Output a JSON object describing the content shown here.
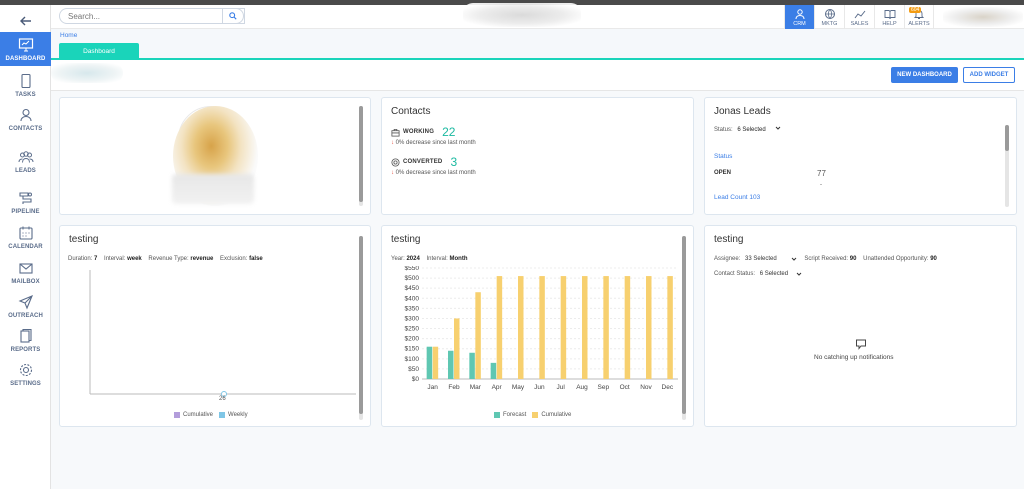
{
  "sidebar": {
    "items": [
      {
        "label": "DASHBOARD",
        "icon": "dashboard-icon"
      },
      {
        "label": "TASKS",
        "icon": "tasks-icon"
      },
      {
        "label": "CONTACTS",
        "icon": "contacts-icon"
      },
      {
        "label": "LEADS",
        "icon": "leads-icon"
      },
      {
        "label": "PIPELINE",
        "icon": "pipeline-icon"
      },
      {
        "label": "CALENDAR",
        "icon": "calendar-icon"
      },
      {
        "label": "MAILBOX",
        "icon": "mailbox-icon"
      },
      {
        "label": "OUTREACH",
        "icon": "outreach-icon"
      },
      {
        "label": "REPORTS",
        "icon": "reports-icon"
      },
      {
        "label": "SETTINGS",
        "icon": "settings-icon"
      }
    ]
  },
  "header": {
    "search_placeholder": "Search...",
    "buttons": [
      {
        "label": "CRM"
      },
      {
        "label": "MKTG"
      },
      {
        "label": "SALES"
      },
      {
        "label": "HELP"
      },
      {
        "label": "ALERTS",
        "badge": "604"
      }
    ]
  },
  "breadcrumb": {
    "home": "Home"
  },
  "tabs": {
    "dashboard": "Dashboard"
  },
  "toolbar": {
    "new_dashboard": "NEW DASHBOARD",
    "add_widget": "ADD WIDGET"
  },
  "contacts_card": {
    "title": "Contacts",
    "working_label": "WORKING",
    "working_value": "22",
    "working_sub": "0% decrease since last month",
    "converted_label": "CONVERTED",
    "converted_value": "3",
    "converted_sub": "0% decrease since last month"
  },
  "leads_card": {
    "title": "Jonas Leads",
    "status_label": "Status:",
    "status_value": "6 Selected",
    "status_heading": "Status",
    "open_label": "OPEN",
    "open_value": "77",
    "dash": "-",
    "lead_count": "Lead Count 103"
  },
  "testing1": {
    "title": "testing",
    "duration_label": "Duration:",
    "duration_value": "7",
    "interval_label": "Interval:",
    "interval_value": "week",
    "revenue_label": "Revenue Type:",
    "revenue_value": "revenue",
    "exclusion_label": "Exclusion:",
    "exclusion_value": "false",
    "x_tick": "26",
    "legend_cumulative": "Cumulative",
    "legend_weekly": "Weekly"
  },
  "testing2": {
    "title": "testing",
    "year_label": "Year:",
    "year_value": "2024",
    "interval_label": "Interval:",
    "interval_value": "Month"
  },
  "testing3": {
    "title": "testing",
    "assignee_label": "Assignee:",
    "assignee_value": "33 Selected",
    "script_label": "Script Received:",
    "script_value": "90",
    "unattended_label": "Unattended Opportunity:",
    "unattended_value": "90",
    "contact_status_label": "Contact Status:",
    "contact_status_value": "6 Selected",
    "empty_message": "No catching up notifications"
  },
  "colors": {
    "primary": "#3b7ee6",
    "teal": "#1ad4ba",
    "forecast": "#5fc7b2",
    "cumulative": "#f7d06f",
    "weekly": "#7fc6e6",
    "cum_legend": "#b39ddb"
  },
  "chart_data": {
    "type": "bar",
    "categories": [
      "Jan",
      "Feb",
      "Mar",
      "Apr",
      "May",
      "Jun",
      "Jul",
      "Aug",
      "Sep",
      "Oct",
      "Nov",
      "Dec"
    ],
    "series": [
      {
        "name": "Forecast",
        "values": [
          160,
          140,
          130,
          80,
          0,
          0,
          0,
          0,
          0,
          0,
          0,
          0
        ]
      },
      {
        "name": "Cumulative",
        "values": [
          160,
          300,
          430,
          510,
          510,
          510,
          510,
          510,
          510,
          510,
          510,
          510
        ]
      }
    ],
    "yticks": [
      "$0",
      "$50",
      "$100",
      "$150",
      "$200",
      "$250",
      "$300",
      "$350",
      "$400",
      "$450",
      "$500",
      "$550"
    ],
    "ylim": [
      0,
      550
    ]
  }
}
